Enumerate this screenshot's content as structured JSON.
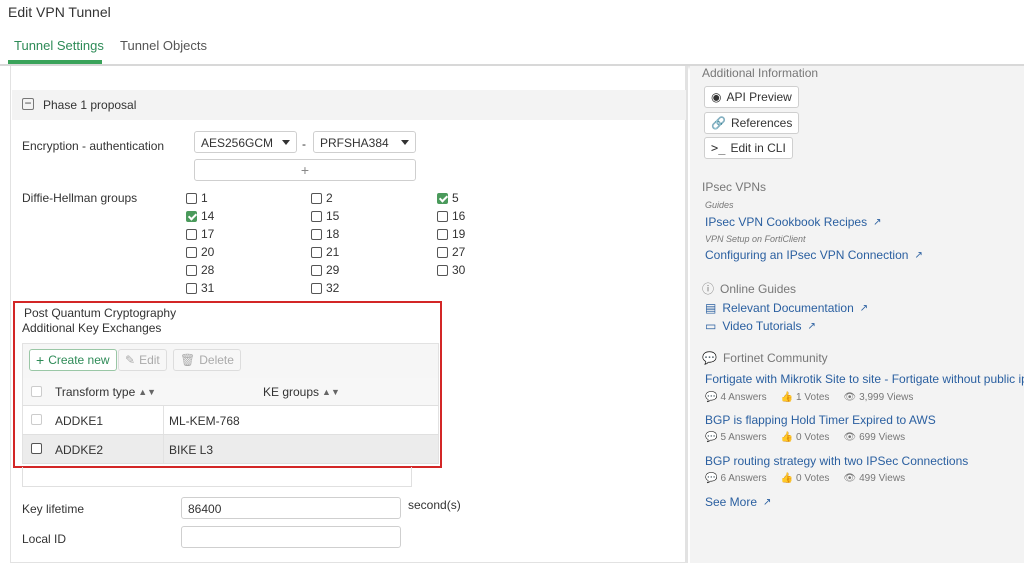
{
  "window": {
    "title": "Edit VPN Tunnel"
  },
  "tabs": [
    {
      "label": "Tunnel Settings",
      "active": true
    },
    {
      "label": "Tunnel Objects",
      "active": false
    }
  ],
  "phase1": {
    "section_title": "Phase 1 proposal",
    "encryption_label": "Encryption - authentication",
    "encryption_value": "AES256GCM",
    "auth_value": "PRFSHA384",
    "dash": "-",
    "add_symbol": "+",
    "dh_label": "Diffie-Hellman groups",
    "dh_groups": [
      {
        "label": "1",
        "checked": false
      },
      {
        "label": "2",
        "checked": false
      },
      {
        "label": "5",
        "checked": true
      },
      {
        "label": "14",
        "checked": true
      },
      {
        "label": "15",
        "checked": false
      },
      {
        "label": "16",
        "checked": false
      },
      {
        "label": "17",
        "checked": false
      },
      {
        "label": "18",
        "checked": false
      },
      {
        "label": "19",
        "checked": false
      },
      {
        "label": "20",
        "checked": false
      },
      {
        "label": "21",
        "checked": false
      },
      {
        "label": "27",
        "checked": false
      },
      {
        "label": "28",
        "checked": false
      },
      {
        "label": "29",
        "checked": false
      },
      {
        "label": "30",
        "checked": false
      },
      {
        "label": "31",
        "checked": false
      },
      {
        "label": "32",
        "checked": false
      }
    ],
    "pqc_title": "Post Quantum Cryptography",
    "pqc_subtitle": "Additional Key Exchanges",
    "toolbar": {
      "create": "Create new",
      "edit": "Edit",
      "delete": "Delete"
    },
    "table": {
      "columns": [
        "Transform type",
        "KE groups"
      ],
      "rows": [
        {
          "transform": "ADDKE1",
          "ke": "ML-KEM-768"
        },
        {
          "transform": "ADDKE2",
          "ke": "BIKE L3"
        }
      ]
    },
    "key_lifetime_label": "Key lifetime",
    "key_lifetime_value": "86400",
    "key_lifetime_unit": "second(s)",
    "local_id_label": "Local ID",
    "local_id_value": ""
  },
  "sidebar": {
    "additional_info": "Additional Information",
    "api_preview": "API Preview",
    "references": "References",
    "edit_cli": "Edit in CLI",
    "ipsec_head": "IPsec VPNs",
    "guides_small": "Guides",
    "cookbook_link": "IPsec VPN Cookbook Recipes",
    "forticlient_small": "VPN Setup on FortiClient",
    "configure_link": "Configuring an IPsec VPN Connection",
    "online_guides": "Online Guides",
    "relevant_docs": "Relevant Documentation",
    "video_tutorials": "Video Tutorials",
    "community_head": "Fortinet Community",
    "posts": [
      {
        "title": "Fortigate with Mikrotik Site to site - Fortigate without public ip",
        "answers": "4 Answers",
        "votes": "1 Votes",
        "views": "3,999 Views"
      },
      {
        "title": "BGP is flapping Hold Timer Expired to AWS",
        "answers": "5 Answers",
        "votes": "0 Votes",
        "views": "699 Views"
      },
      {
        "title": "BGP routing strategy with two IPSec Connections",
        "answers": "6 Answers",
        "votes": "0 Votes",
        "views": "499 Views"
      }
    ],
    "see_more": "See More"
  }
}
